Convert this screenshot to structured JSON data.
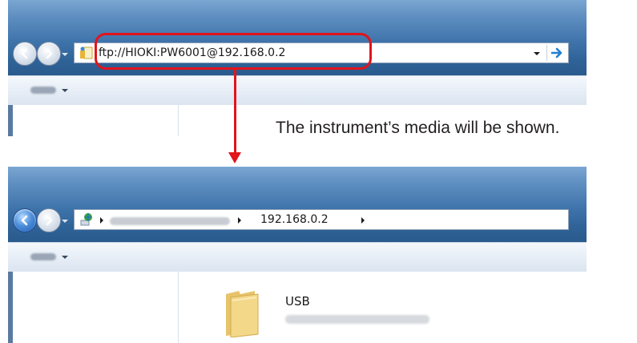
{
  "before": {
    "address_text": "ftp://HIOKI:PW6001@192.168.0.2",
    "organize_icon": "chevron-down-icon",
    "go_icon": "arrow-right-icon"
  },
  "caption": "The instrument’s media will be shown.",
  "after": {
    "breadcrumb": [
      "192.168.0.2"
    ],
    "folder_name": "USB",
    "folder_icon": "folder-icon",
    "location_icon": "network-globe-icon"
  },
  "colors": {
    "callout": "#e2141c",
    "chrome_top": "#7aa6d2",
    "chrome_bottom": "#2a5a8c",
    "toolbar": "#e6edf6"
  }
}
